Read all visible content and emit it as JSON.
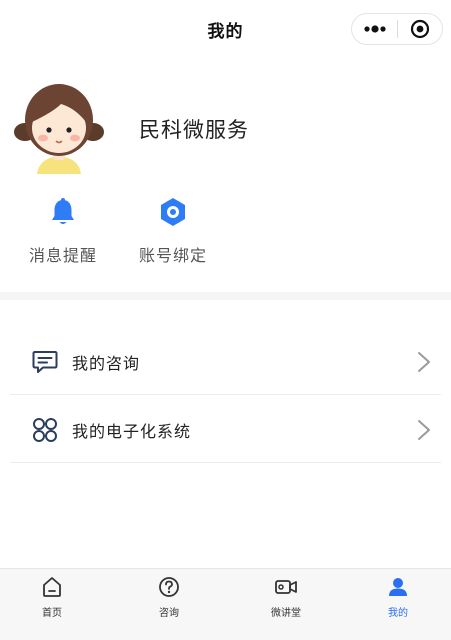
{
  "header": {
    "title": "我的",
    "more_icon": "more-dots-icon",
    "close_icon": "target-close-icon"
  },
  "profile": {
    "name": "民科微服务",
    "avatar_icon": "girl-avatar"
  },
  "quick_actions": [
    {
      "label": "消息提醒",
      "icon": "bell-icon",
      "color": "#2f7df6"
    },
    {
      "label": "账号绑定",
      "icon": "gear-icon",
      "color": "#2f7df6"
    }
  ],
  "menu": [
    {
      "label": "我的咨询",
      "icon": "chat-bubble-icon"
    },
    {
      "label": "我的电子化系统",
      "icon": "four-circles-icon"
    }
  ],
  "tabbar": {
    "items": [
      {
        "label": "首页",
        "icon": "home-icon",
        "active": false
      },
      {
        "label": "咨询",
        "icon": "question-icon",
        "active": false
      },
      {
        "label": "微讲堂",
        "icon": "video-icon",
        "active": false
      },
      {
        "label": "我的",
        "icon": "user-icon",
        "active": true
      }
    ],
    "active_color": "#2a6ff0"
  },
  "colors": {
    "accent": "#2f7df6",
    "background": "#ffffff"
  }
}
